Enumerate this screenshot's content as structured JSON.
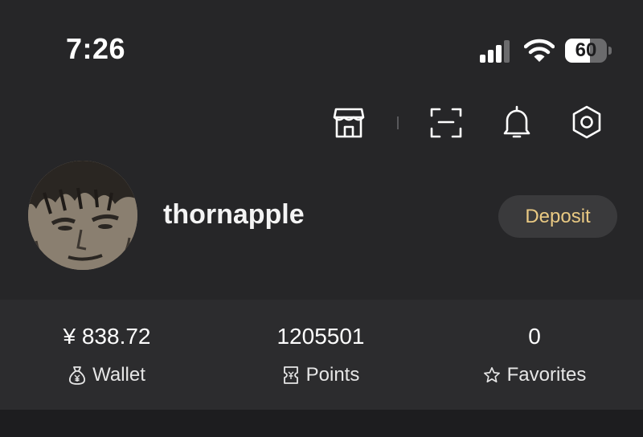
{
  "status_bar": {
    "time": "7:26",
    "battery_percent": "60",
    "battery_level": 0.6
  },
  "toolbar": {
    "icons": [
      "store-icon",
      "scan-icon",
      "bell-icon",
      "gear-icon"
    ]
  },
  "profile": {
    "username": "thornapple",
    "deposit_label": "Deposit"
  },
  "stats": {
    "wallet": {
      "value": "¥ 838.72",
      "label": "Wallet",
      "icon": "money-bag-icon"
    },
    "points": {
      "value": "1205501",
      "label": "Points",
      "icon": "ticket-icon"
    },
    "favorites": {
      "value": "0",
      "label": "Favorites",
      "icon": "star-icon"
    }
  },
  "colors": {
    "background": "#262628",
    "panel": "#2c2c2e",
    "deposit_text": "#e9c983",
    "deposit_bg": "#3a3a3c"
  }
}
